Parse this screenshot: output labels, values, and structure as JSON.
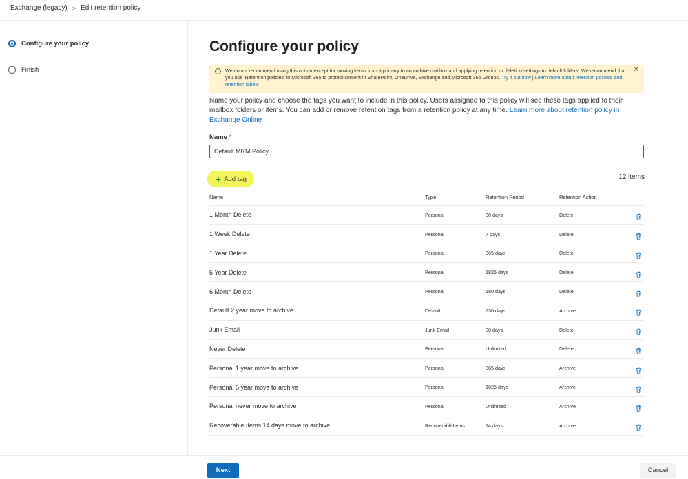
{
  "breadcrumb": {
    "root": "Exchange (legacy)",
    "separator": ">",
    "current": "Edit retention policy"
  },
  "steps": [
    {
      "label": "Configure your policy",
      "state": "current"
    },
    {
      "label": "Finish",
      "state": "pending"
    }
  ],
  "page": {
    "title": "Configure your policy"
  },
  "warning": {
    "text": "We do not recommend using this option except for moving items from a primary to an archive mailbox and applying retention or deletion settings to default folders. We recommend that you use 'Retention policies' in Microsoft 365 to protect content in SharePoint, OneDrive, Exchange and Microsoft 365 Groups.",
    "link1": "Try it out now",
    "divider": " | ",
    "link2": "Learn more about retention policies and retention labels",
    "info_icon": "info-icon",
    "close_icon": "close-icon"
  },
  "description": {
    "text": "Name your policy and choose the tags you want to include in this policy. Users assigned to this policy will see these tags applied to their mailbox folders or items. You can add or remove retention tags from a retention policy at any time.",
    "link": "Learn more about retention policy in Exchange Online"
  },
  "name_field": {
    "label": "Name",
    "required_mark": "*",
    "value": "Default MRM Policy"
  },
  "toolbar": {
    "add_tag_label": "Add tag",
    "add_icon": "plus-icon",
    "items_count": "12 items"
  },
  "table": {
    "headers": {
      "name": "Name",
      "type": "Type",
      "period": "Retention Period",
      "action": "Retention Action"
    },
    "rows": [
      {
        "name": "1 Month Delete",
        "type": "Personal",
        "period": "30 days",
        "action": "Delete"
      },
      {
        "name": "1 Week Delete",
        "type": "Personal",
        "period": "7 days",
        "action": "Delete"
      },
      {
        "name": "1 Year Delete",
        "type": "Personal",
        "period": "365 days",
        "action": "Delete"
      },
      {
        "name": "5 Year Delete",
        "type": "Personal",
        "period": "1825 days",
        "action": "Delete"
      },
      {
        "name": "6 Month Delete",
        "type": "Personal",
        "period": "180 days",
        "action": "Delete"
      },
      {
        "name": "Default 2 year move to archive",
        "type": "Default",
        "period": "730 days",
        "action": "Archive"
      },
      {
        "name": "Junk Email",
        "type": "Junk Email",
        "period": "30 days",
        "action": "Delete"
      },
      {
        "name": "Never Delete",
        "type": "Personal",
        "period": "Unlimited",
        "action": "Delete"
      },
      {
        "name": "Personal 1 year move to archive",
        "type": "Personal",
        "period": "365 days",
        "action": "Archive"
      },
      {
        "name": "Personal 5 year move to archive",
        "type": "Personal",
        "period": "1825 days",
        "action": "Archive"
      },
      {
        "name": "Personal never move to archive",
        "type": "Personal",
        "period": "Unlimited",
        "action": "Archive"
      },
      {
        "name": "Recoverable Items 14 days move to archive",
        "type": "RecoverableItems",
        "period": "14 days",
        "action": "Archive"
      }
    ],
    "delete_icon": "trash-icon"
  },
  "footer": {
    "next_label": "Next",
    "cancel_label": "Cancel"
  },
  "colors": {
    "accent": "#0f6cbd",
    "warning_bg": "#fff4ce",
    "highlight": "#f3f35a"
  }
}
